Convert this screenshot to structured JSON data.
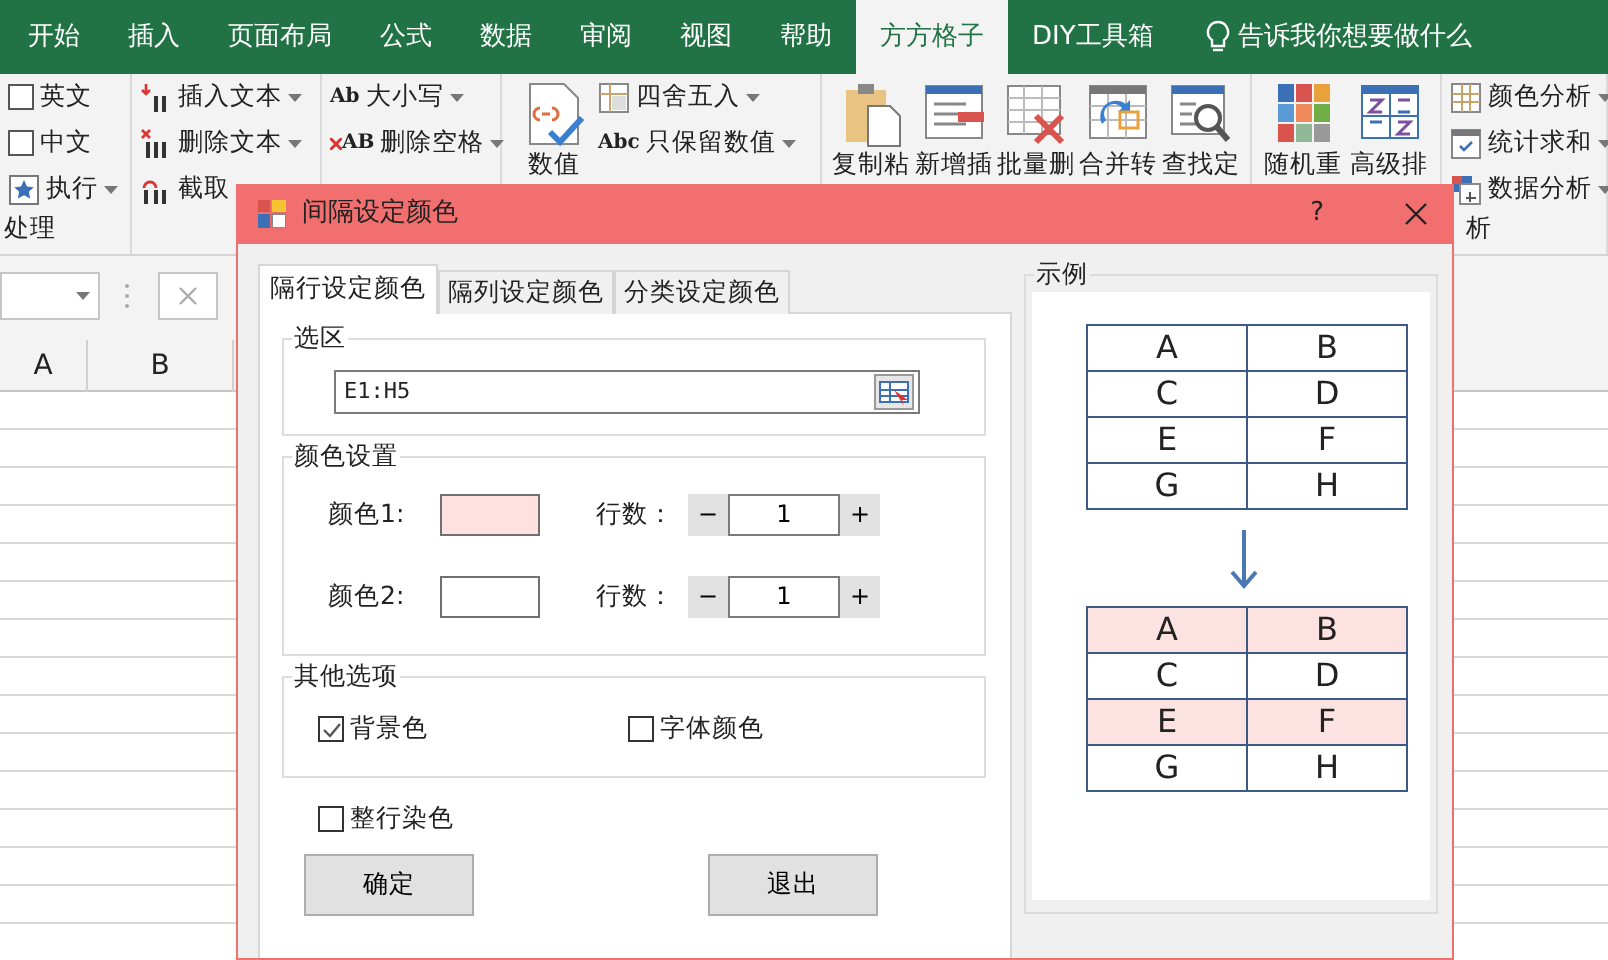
{
  "ribbon_tabs": [
    {
      "label": "开始",
      "selected": false
    },
    {
      "label": "插入",
      "selected": false
    },
    {
      "label": "页面布局",
      "selected": false
    },
    {
      "label": "公式",
      "selected": false
    },
    {
      "label": "数据",
      "selected": false
    },
    {
      "label": "审阅",
      "selected": false
    },
    {
      "label": "视图",
      "selected": false
    },
    {
      "label": "帮助",
      "selected": false
    },
    {
      "label": "方方格子",
      "selected": true
    },
    {
      "label": "DIY工具箱",
      "selected": false
    }
  ],
  "tell_me": "告诉我你想要做什么",
  "ribbon_groups": [
    {
      "label": "处理",
      "small": [
        {
          "kind": "checkbox",
          "label": "英文",
          "checked": false
        },
        {
          "kind": "checkbox",
          "label": "中文",
          "checked": false
        },
        {
          "kind": "dropdown",
          "label": "执行"
        }
      ]
    },
    {
      "small": [
        {
          "kind": "dropdown",
          "label": "插入文本"
        },
        {
          "kind": "dropdown",
          "label": "删除文本"
        },
        {
          "kind": "plain",
          "label": "截取"
        }
      ]
    },
    {
      "small": [
        {
          "kind": "dropdown",
          "label": "大小写",
          "icon_text": "Ab"
        },
        {
          "kind": "dropdown",
          "label": "删除空格",
          "icon_text": "AB"
        }
      ]
    },
    {
      "large": [
        "数值"
      ],
      "small": [
        {
          "kind": "dropdown",
          "label": "四舍五入"
        },
        {
          "kind": "dropdown",
          "label": "只保留数值",
          "icon_text": "Abc"
        }
      ]
    },
    {
      "large": [
        "复制粘",
        "新增插",
        "批量删",
        "合并转",
        "查找定"
      ]
    },
    {
      "large": [
        "随机重",
        "高级排"
      ]
    },
    {
      "label": "析",
      "small": [
        {
          "kind": "dropdown",
          "label": "颜色分析"
        },
        {
          "kind": "dropdown",
          "label": "统计求和"
        },
        {
          "kind": "dropdown",
          "label": "数据分析"
        }
      ]
    }
  ],
  "columns": [
    "A",
    "B"
  ],
  "dialog": {
    "title": "间隔设定颜色",
    "help": "?",
    "tabs": [
      {
        "label": "隔行设定颜色",
        "selected": true
      },
      {
        "label": "隔列设定颜色",
        "selected": false
      },
      {
        "label": "分类设定颜色",
        "selected": false
      }
    ],
    "selection": {
      "legend": "选区",
      "value": "E1:H5"
    },
    "color_settings": {
      "legend": "颜色设置",
      "rows": [
        {
          "label": "颜色1:",
          "color": "#ffe1e1",
          "count_label": "行数：",
          "minus": "−",
          "count": "1",
          "plus": "+"
        },
        {
          "label": "颜色2:",
          "color": "#ffffff",
          "count_label": "行数：",
          "minus": "−",
          "count": "1",
          "plus": "+"
        }
      ]
    },
    "other_options": {
      "legend": "其他选项",
      "checks": [
        {
          "label": "背景色",
          "checked": true
        },
        {
          "label": "字体颜色",
          "checked": false
        }
      ]
    },
    "whole_row": {
      "label": "整行染色",
      "checked": false
    },
    "buttons": [
      "确定",
      "退出"
    ],
    "example": {
      "legend": "示例",
      "before": [
        [
          "A",
          "B"
        ],
        [
          "C",
          "D"
        ],
        [
          "E",
          "F"
        ],
        [
          "G",
          "H"
        ]
      ],
      "after": [
        {
          "cells": [
            "A",
            "B"
          ],
          "highlighted": true
        },
        {
          "cells": [
            "C",
            "D"
          ],
          "highlighted": false
        },
        {
          "cells": [
            "E",
            "F"
          ],
          "highlighted": true
        },
        {
          "cells": [
            "G",
            "H"
          ],
          "highlighted": false
        }
      ]
    }
  }
}
